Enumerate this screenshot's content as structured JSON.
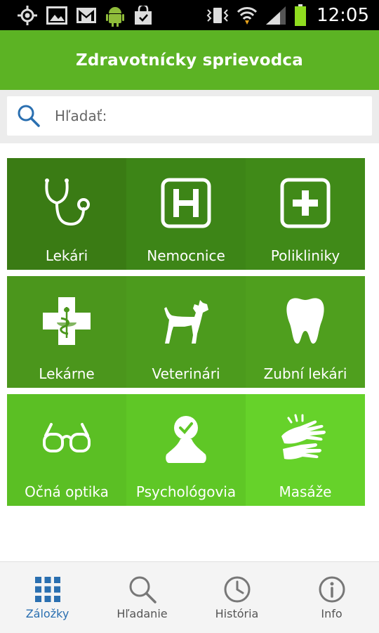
{
  "status_bar": {
    "time": "12:05"
  },
  "app": {
    "title": "Zdravotnícky sprievodca"
  },
  "search": {
    "placeholder": "Hľadať:",
    "value": ""
  },
  "categories": [
    {
      "label": "Lekári",
      "icon": "stethoscope-icon",
      "color": "#3a7b14"
    },
    {
      "label": "Nemocnice",
      "icon": "hospital-icon",
      "color": "#3d8517"
    },
    {
      "label": "Polikliniky",
      "icon": "medical-cross-icon",
      "color": "#408a18"
    },
    {
      "label": "Lekárne",
      "icon": "pharmacy-icon",
      "color": "#4b961c"
    },
    {
      "label": "Veterinári",
      "icon": "dog-icon",
      "color": "#4c9b1d"
    },
    {
      "label": "Zubní lekári",
      "icon": "tooth-icon",
      "color": "#4f9f1e"
    },
    {
      "label": "Očná optika",
      "icon": "glasses-icon",
      "color": "#5bbf24"
    },
    {
      "label": "Psychológovia",
      "icon": "person-check-icon",
      "color": "#5fc726"
    },
    {
      "label": "Masáže",
      "icon": "massage-hands-icon",
      "color": "#66d22a"
    }
  ],
  "bottom_nav": [
    {
      "label": "Záložky",
      "icon": "grid-icon",
      "active": true
    },
    {
      "label": "Hľadanie",
      "icon": "search-icon",
      "active": false
    },
    {
      "label": "História",
      "icon": "clock-icon",
      "active": false
    },
    {
      "label": "Info",
      "icon": "info-icon",
      "active": false
    }
  ],
  "colors": {
    "accent_green": "#5cb324",
    "active_blue": "#2a6fb0"
  }
}
